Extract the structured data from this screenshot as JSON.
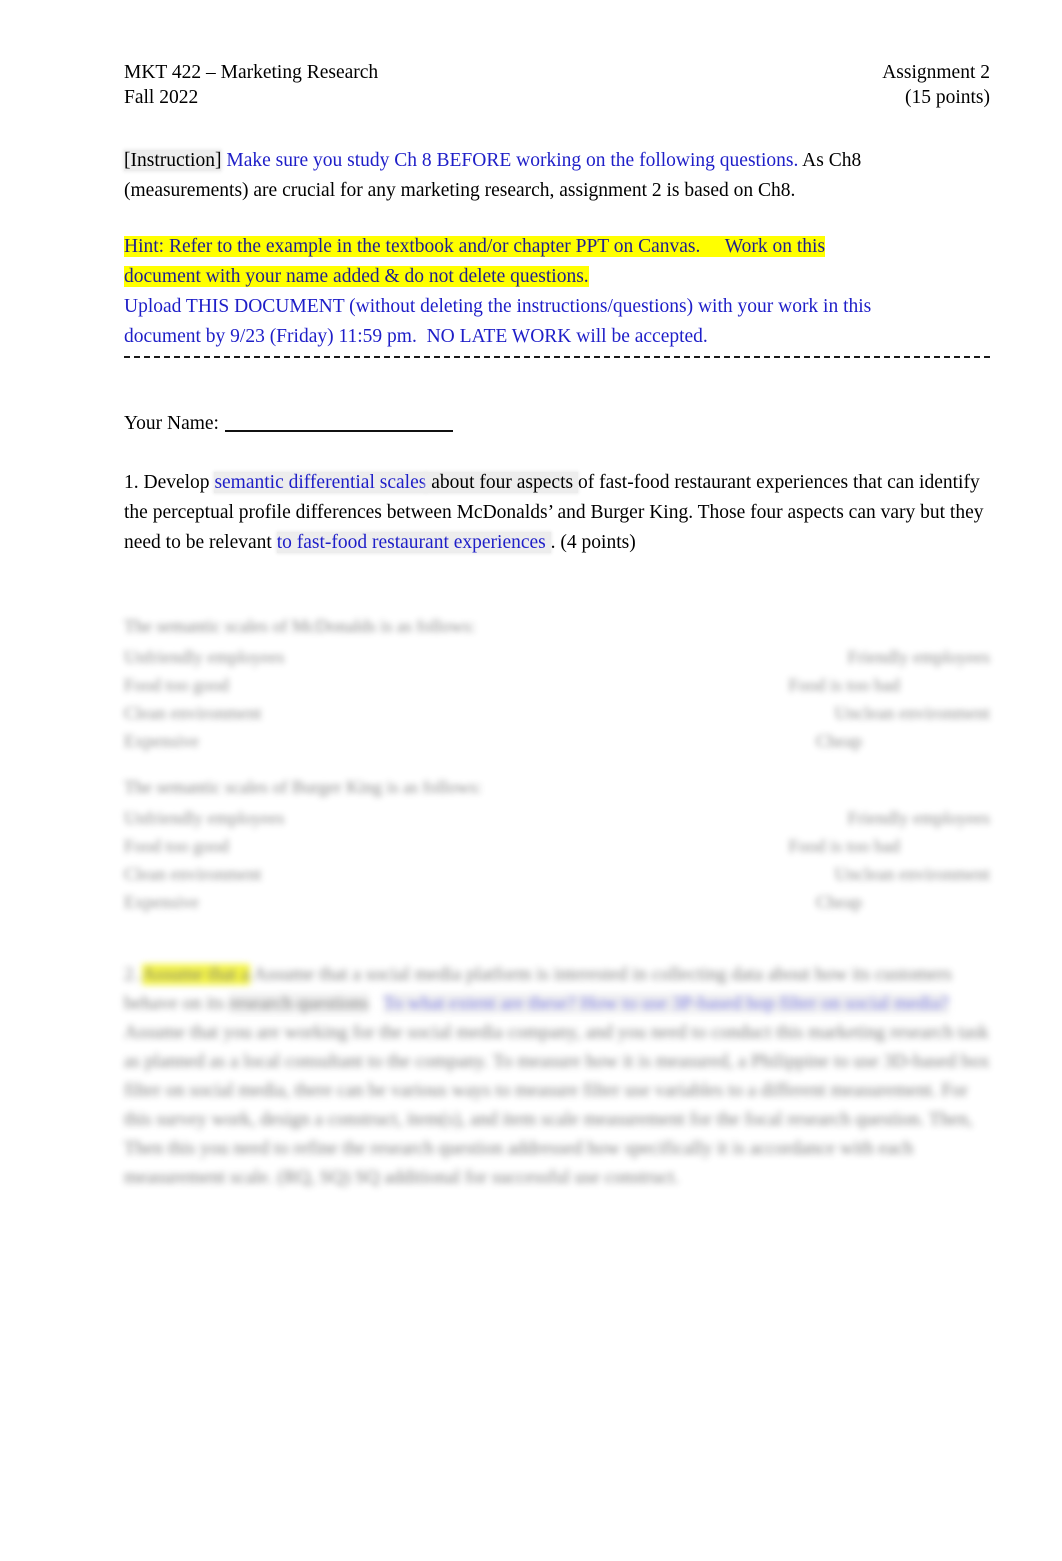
{
  "document": {
    "header": {
      "course": "MKT 422 – Marketing Research",
      "term": "Fall 2022",
      "assignment": "Assignment 2",
      "points": "(15 points)"
    },
    "instruction": {
      "label": "[Instruction]",
      "blue_text": "Make sure you study Ch 8 BEFORE working on the following questions.",
      "rest": " As Ch8 (measurements) are crucial for any marketing research, assignment 2 is based on Ch8."
    },
    "hint": {
      "line1": "Hint: Refer to the example in the textbook and/or chapter PPT on Canvas.",
      "line1_tail": "Work on this",
      "line2a": "document ",
      "line2b": "with your name added ",
      "line2c": "& do not delete questions."
    },
    "upload": {
      "line1": "Upload THIS DOCUMENT (without deleting the instructions/questions) with your work in this",
      "line2a": "document by 9/23 (Friday) 11:59 pm.",
      "line2b": "NO LATE WORK will be accepted."
    },
    "name_field": {
      "label": "Your Name:",
      "value": ""
    },
    "question1": {
      "number": "1. Develop",
      "highlight1": "semantic differential scales",
      "mid1": " about four aspects ",
      "mid2": " of fast-food restaurant experiences that can identify the perceptual profile differences between McDonalds’ and Burger King. Those four aspects can vary but they need to be relevant ",
      "highlight2": "to fast-food restaurant experiences ",
      "tail": ". (4 points)"
    },
    "scale_blocks": [
      {
        "name": "mcdonalds",
        "title": "The semantic scales of McDonalds is as follows:",
        "rows": [
          {
            "left": "Unfriendly employees",
            "right": "Friendly employees"
          },
          {
            "left": "Food too good",
            "right": "Food is too bad"
          },
          {
            "left": "Clean environment",
            "right": "Unclean environment"
          },
          {
            "left": "Expensive",
            "right": "Cheap"
          }
        ]
      },
      {
        "name": "burgerking",
        "title": "The semantic scales of Burger King is as follows:",
        "rows": [
          {
            "left": "Unfriendly employees",
            "right": "Friendly employees"
          },
          {
            "left": "Food too good",
            "right": "Food is too bad"
          },
          {
            "left": "Clean environment",
            "right": "Unclean environment"
          },
          {
            "left": "Expensive",
            "right": "Cheap"
          }
        ]
      }
    ],
    "question2": {
      "number": "2.",
      "highlight_yellow": "Assume that a",
      "seg1": " Assume that a social media platform is interested in collecting data about how its customers behave on its ",
      "seg2": "research questions",
      "blue_segment": "To what extent are these? How to use 3P-based hop filter on social media?",
      "seg3": " Assume that you are working for the social media company, and you need to conduct this marketing research task as planned as a local consultant to the company. To measure how it is measured, a Philippine to use 3D-based box filter on social media, there can be various ways to measure filter use variables to a different measurement. For this survey work, design a construct, item(s), and item scale measurement for the focal research question. Then, Then this you need to refine the research question addressed how specifically it is accordance with each measurement scale. (RQ, SQ) SQ additional for successful use construct."
    }
  }
}
